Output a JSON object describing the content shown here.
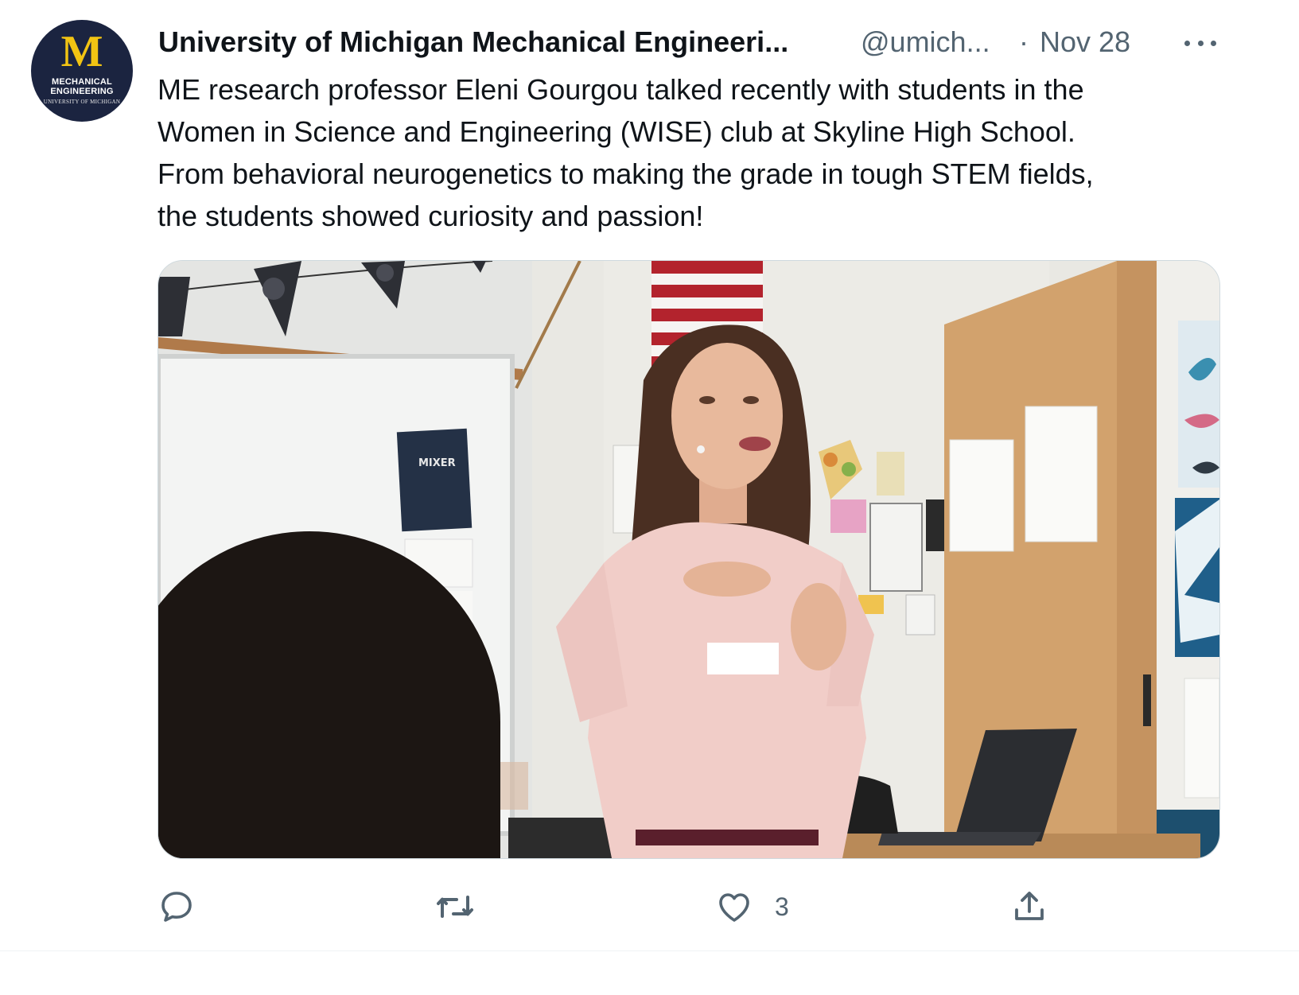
{
  "account": {
    "avatar": {
      "letter": "M",
      "line1": "MECHANICAL",
      "line2": "ENGINEERING",
      "line3": "UNIVERSITY OF MICHIGAN"
    },
    "display_name": "University of Michigan Mechanical Engineeri...",
    "handle": "@umich...",
    "separator": "·",
    "date": "Nov 28"
  },
  "tweet": {
    "lines": [
      "ME research professor Eleni Gourgou talked recently with students in the",
      "Women in Science and Engineering (WISE) club at Skyline High School.",
      "From behavioral neurogenetics to making the grade in tough STEM fields,",
      "the students showed curiosity and passion!"
    ]
  },
  "photo": {
    "poster_title": "MIXER"
  },
  "actions": {
    "reply": {
      "icon": "reply-icon"
    },
    "retweet": {
      "icon": "retweet-icon"
    },
    "like": {
      "icon": "heart-icon",
      "count": "3"
    },
    "share": {
      "icon": "share-icon"
    }
  },
  "colors": {
    "text": "#0f1419",
    "secondary": "#536471",
    "avatar_bg": "#1b2440",
    "maize": "#f2c413"
  }
}
